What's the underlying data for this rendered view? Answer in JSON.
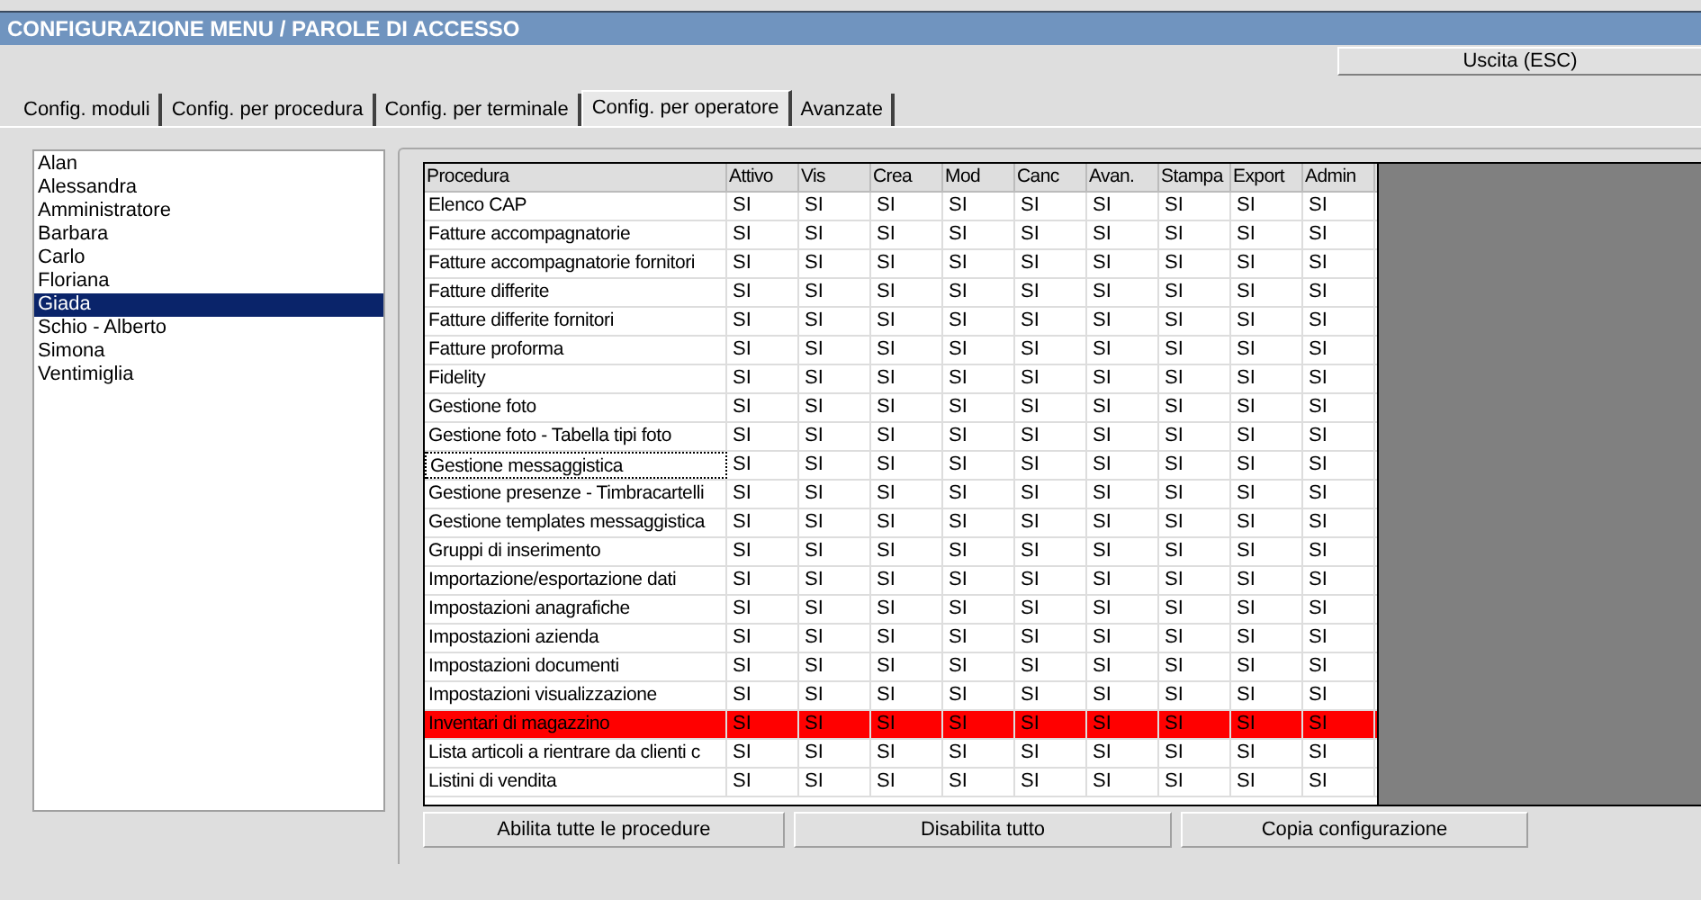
{
  "window": {
    "title": "CONFIGURAZIONE MENU / PAROLE DI ACCESSO"
  },
  "exit_button": "Uscita (ESC)",
  "tabs": [
    {
      "label": "Config. moduli",
      "selected": false
    },
    {
      "label": "Config. per procedura",
      "selected": false
    },
    {
      "label": "Config. per terminale",
      "selected": false
    },
    {
      "label": "Config. per operatore",
      "selected": true
    },
    {
      "label": "Avanzate",
      "selected": false
    }
  ],
  "operators": [
    {
      "name": "Alan",
      "selected": false
    },
    {
      "name": "Alessandra",
      "selected": false
    },
    {
      "name": "Amministratore",
      "selected": false
    },
    {
      "name": "Barbara",
      "selected": false
    },
    {
      "name": "Carlo",
      "selected": false
    },
    {
      "name": "Floriana",
      "selected": false
    },
    {
      "name": "Giada",
      "selected": true
    },
    {
      "name": "Schio - Alberto",
      "selected": false
    },
    {
      "name": "Simona",
      "selected": false
    },
    {
      "name": "Ventimiglia",
      "selected": false
    }
  ],
  "grid": {
    "columns": [
      "Procedura",
      "Attivo",
      "Vis",
      "Crea",
      "Mod",
      "Canc",
      "Avan.",
      "Stampa",
      "Export",
      "Admin"
    ],
    "rows": [
      {
        "procedura": "Elenco CAP",
        "values": [
          "SI",
          "SI",
          "SI",
          "SI",
          "SI",
          "SI",
          "SI",
          "SI",
          "SI"
        ],
        "highlighted": false,
        "focused": false
      },
      {
        "procedura": "Fatture accompagnatorie",
        "values": [
          "SI",
          "SI",
          "SI",
          "SI",
          "SI",
          "SI",
          "SI",
          "SI",
          "SI"
        ],
        "highlighted": false,
        "focused": false
      },
      {
        "procedura": "Fatture accompagnatorie fornitori",
        "values": [
          "SI",
          "SI",
          "SI",
          "SI",
          "SI",
          "SI",
          "SI",
          "SI",
          "SI"
        ],
        "highlighted": false,
        "focused": false
      },
      {
        "procedura": "Fatture differite",
        "values": [
          "SI",
          "SI",
          "SI",
          "SI",
          "SI",
          "SI",
          "SI",
          "SI",
          "SI"
        ],
        "highlighted": false,
        "focused": false
      },
      {
        "procedura": "Fatture differite fornitori",
        "values": [
          "SI",
          "SI",
          "SI",
          "SI",
          "SI",
          "SI",
          "SI",
          "SI",
          "SI"
        ],
        "highlighted": false,
        "focused": false
      },
      {
        "procedura": "Fatture proforma",
        "values": [
          "SI",
          "SI",
          "SI",
          "SI",
          "SI",
          "SI",
          "SI",
          "SI",
          "SI"
        ],
        "highlighted": false,
        "focused": false
      },
      {
        "procedura": "Fidelity",
        "values": [
          "SI",
          "SI",
          "SI",
          "SI",
          "SI",
          "SI",
          "SI",
          "SI",
          "SI"
        ],
        "highlighted": false,
        "focused": false
      },
      {
        "procedura": "Gestione foto",
        "values": [
          "SI",
          "SI",
          "SI",
          "SI",
          "SI",
          "SI",
          "SI",
          "SI",
          "SI"
        ],
        "highlighted": false,
        "focused": false
      },
      {
        "procedura": "Gestione foto - Tabella tipi foto",
        "values": [
          "SI",
          "SI",
          "SI",
          "SI",
          "SI",
          "SI",
          "SI",
          "SI",
          "SI"
        ],
        "highlighted": false,
        "focused": false
      },
      {
        "procedura": "Gestione messaggistica",
        "values": [
          "SI",
          "SI",
          "SI",
          "SI",
          "SI",
          "SI",
          "SI",
          "SI",
          "SI"
        ],
        "highlighted": false,
        "focused": true
      },
      {
        "procedura": "Gestione presenze - Timbracartelli",
        "values": [
          "SI",
          "SI",
          "SI",
          "SI",
          "SI",
          "SI",
          "SI",
          "SI",
          "SI"
        ],
        "highlighted": false,
        "focused": false
      },
      {
        "procedura": "Gestione templates messaggistica",
        "values": [
          "SI",
          "SI",
          "SI",
          "SI",
          "SI",
          "SI",
          "SI",
          "SI",
          "SI"
        ],
        "highlighted": false,
        "focused": false
      },
      {
        "procedura": "Gruppi di inserimento",
        "values": [
          "SI",
          "SI",
          "SI",
          "SI",
          "SI",
          "SI",
          "SI",
          "SI",
          "SI"
        ],
        "highlighted": false,
        "focused": false
      },
      {
        "procedura": "Importazione/esportazione dati",
        "values": [
          "SI",
          "SI",
          "SI",
          "SI",
          "SI",
          "SI",
          "SI",
          "SI",
          "SI"
        ],
        "highlighted": false,
        "focused": false
      },
      {
        "procedura": "Impostazioni anagrafiche",
        "values": [
          "SI",
          "SI",
          "SI",
          "SI",
          "SI",
          "SI",
          "SI",
          "SI",
          "SI"
        ],
        "highlighted": false,
        "focused": false
      },
      {
        "procedura": "Impostazioni azienda",
        "values": [
          "SI",
          "SI",
          "SI",
          "SI",
          "SI",
          "SI",
          "SI",
          "SI",
          "SI"
        ],
        "highlighted": false,
        "focused": false
      },
      {
        "procedura": "Impostazioni documenti",
        "values": [
          "SI",
          "SI",
          "SI",
          "SI",
          "SI",
          "SI",
          "SI",
          "SI",
          "SI"
        ],
        "highlighted": false,
        "focused": false
      },
      {
        "procedura": "Impostazioni visualizzazione",
        "values": [
          "SI",
          "SI",
          "SI",
          "SI",
          "SI",
          "SI",
          "SI",
          "SI",
          "SI"
        ],
        "highlighted": false,
        "focused": false
      },
      {
        "procedura": "Inventari di magazzino",
        "values": [
          "SI",
          "SI",
          "SI",
          "SI",
          "SI",
          "SI",
          "SI",
          "SI",
          "SI"
        ],
        "highlighted": true,
        "focused": false
      },
      {
        "procedura": "Lista articoli a rientrare da clienti c",
        "values": [
          "SI",
          "SI",
          "SI",
          "SI",
          "SI",
          "SI",
          "SI",
          "SI",
          "SI"
        ],
        "highlighted": false,
        "focused": false
      },
      {
        "procedura": "Listini di vendita",
        "values": [
          "SI",
          "SI",
          "SI",
          "SI",
          "SI",
          "SI",
          "SI",
          "SI",
          "SI"
        ],
        "highlighted": false,
        "focused": false
      }
    ]
  },
  "buttons": [
    "Abilita tutte le procedure",
    "Disabilita tutto",
    "Copia configurazione"
  ]
}
